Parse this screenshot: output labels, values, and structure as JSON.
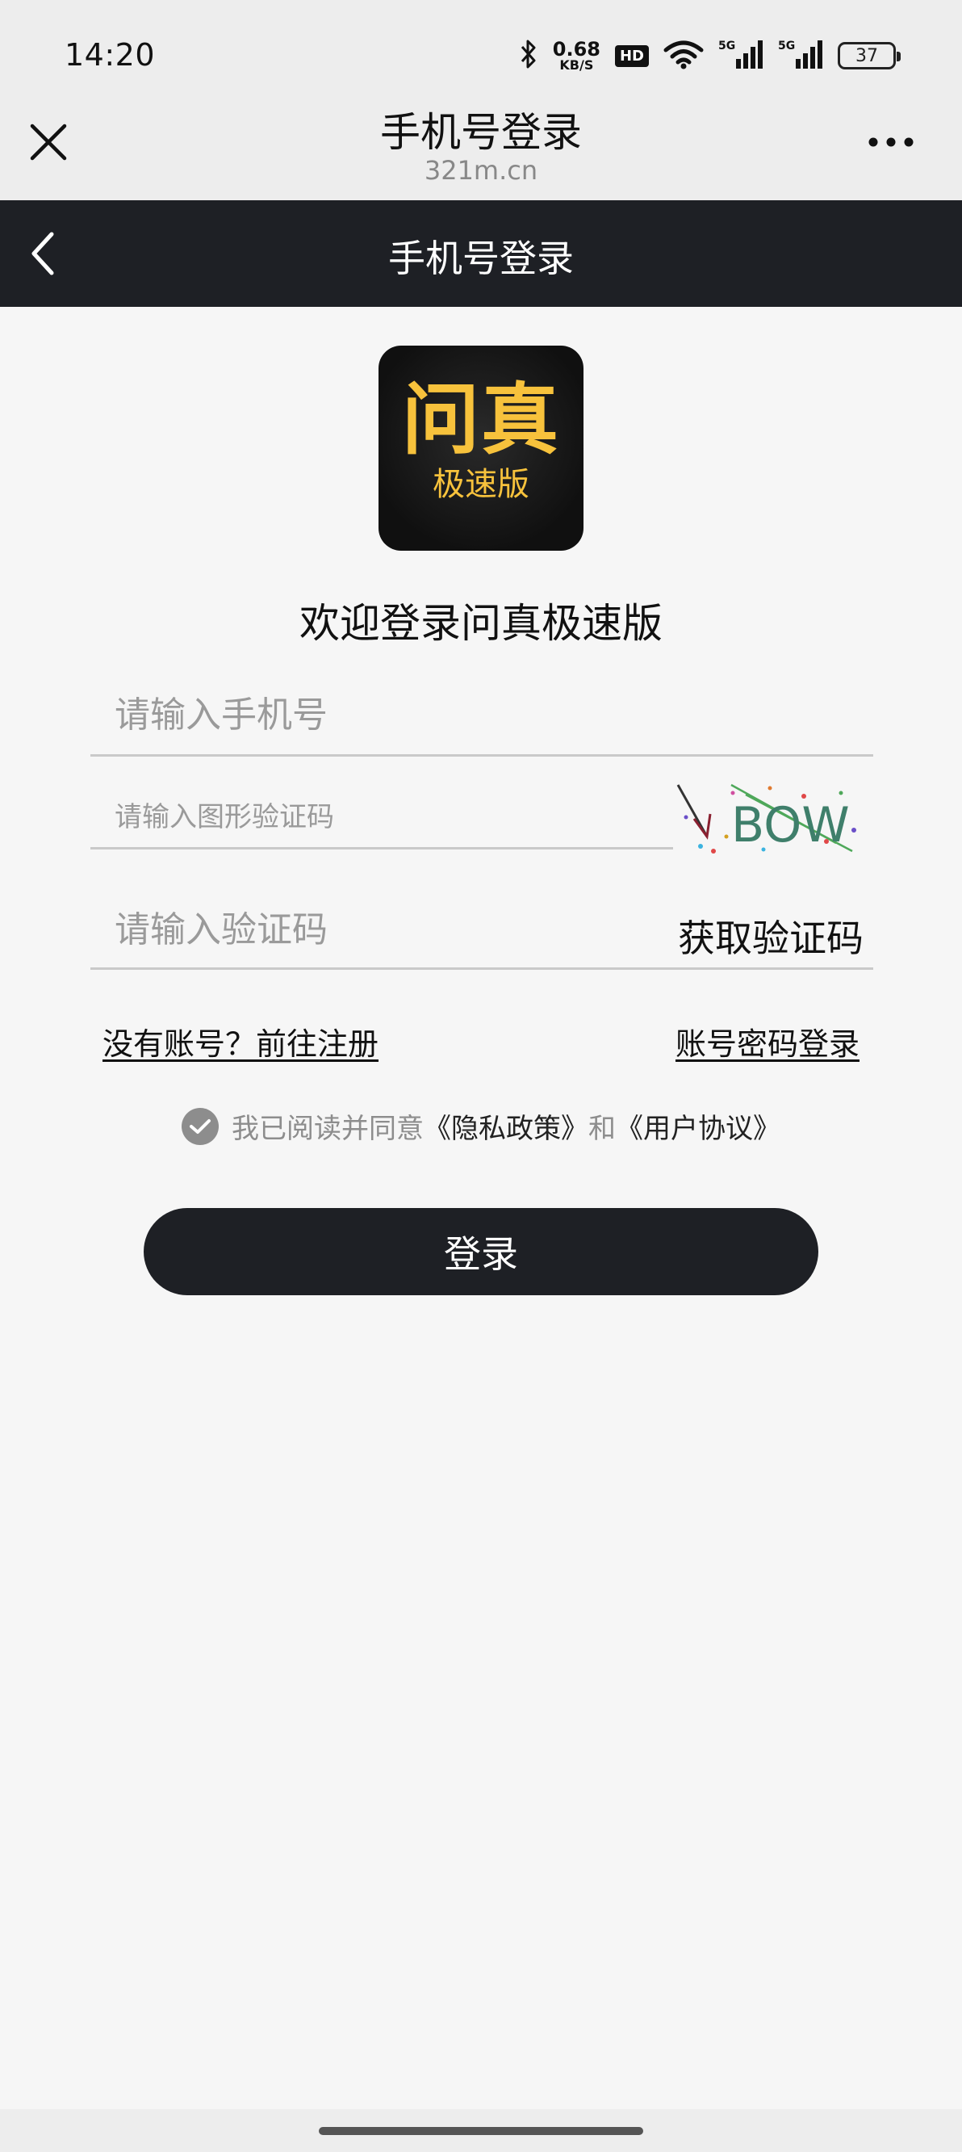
{
  "status_bar": {
    "time": "14:20",
    "net_speed_value": "0.68",
    "net_speed_unit": "KB/S",
    "hd_badge": "HD",
    "signal_1_label": "5G",
    "signal_2_label": "5G",
    "battery": "37",
    "icons": [
      "bluetooth-icon",
      "wifi-icon",
      "signal-icon",
      "signal-icon",
      "battery-icon"
    ]
  },
  "browser": {
    "title": "手机号登录",
    "domain": "321m.cn",
    "close_icon": "close-icon",
    "more_icon": "more-icon"
  },
  "page": {
    "title": "手机号登录",
    "back_icon": "chevron-left-icon"
  },
  "logo": {
    "main": "问真",
    "sub": "极速版",
    "brand_color": "#f7c23c"
  },
  "welcome": "欢迎登录问真极速版",
  "form": {
    "phone_placeholder": "请输入手机号",
    "phone_value": "",
    "captcha_placeholder": "请输入图形验证码",
    "captcha_value": "",
    "captcha_image_text": "BOW",
    "code_placeholder": "请输入验证码",
    "code_value": "",
    "get_code_label": "获取验证码"
  },
  "links": {
    "register": "没有账号？前往注册",
    "password_login": "账号密码登录"
  },
  "agreement": {
    "checked": true,
    "text_before": "我已阅读并同意",
    "privacy": "《隐私政策》",
    "and": "和",
    "user_agreement": "《用户协议》"
  },
  "login_button": "登录",
  "colors": {
    "dark": "#1e2025",
    "background": "#f6f6f6",
    "muted": "#8d8d8d"
  }
}
